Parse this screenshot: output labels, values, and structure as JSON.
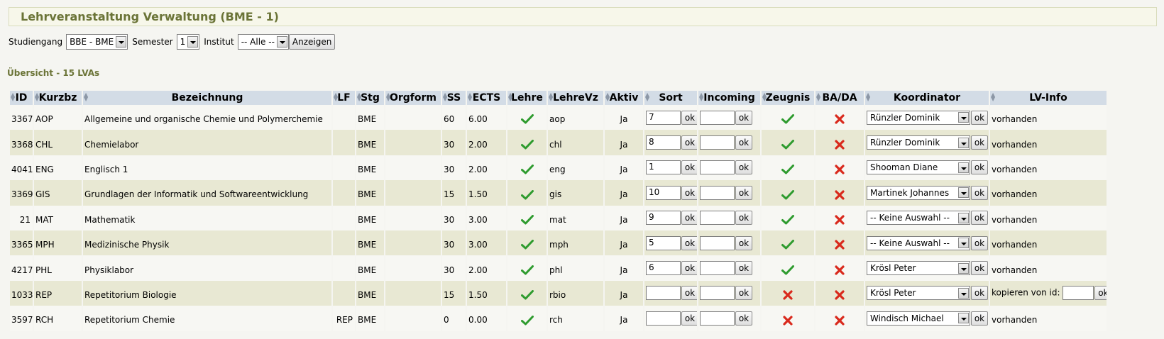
{
  "page": {
    "title": "Lehrveranstaltung Verwaltung (BME - 1)"
  },
  "filter": {
    "studiengang_label": "Studiengang",
    "studiengang_value": "BBE - BME",
    "semester_label": "Semester",
    "semester_value": "1",
    "institut_label": "Institut",
    "institut_value": "-- Alle --",
    "show_button": "Anzeigen"
  },
  "overview": "Übersicht - 15 LVAs",
  "table": {
    "headers": {
      "id": "ID",
      "kurzbz": "Kurzbz",
      "bezeichnung": "Bezeichnung",
      "lf": "LF",
      "stg": "Stg",
      "orgform": "Orgform",
      "ss": "SS",
      "ects": "ECTS",
      "lehre": "Lehre",
      "lehrevz": "LehreVz",
      "aktiv": "Aktiv",
      "sort": "Sort",
      "incoming": "Incoming",
      "zeugnis": "Zeugnis",
      "bada": "BA/DA",
      "koordinator": "Koordinator",
      "lvinfo": "LV-Info"
    },
    "ok_label": "ok",
    "rows": [
      {
        "id": "3367",
        "kurzbz": "AOP",
        "bezeichnung": "Allgemeine und organische Chemie und Polymerchemie",
        "lf": "",
        "stg": "BME",
        "orgform": "",
        "ss": "60",
        "ects": "6.00",
        "lehre": "check",
        "lehrevz": "aop",
        "aktiv": "Ja",
        "sort": "7",
        "incoming": "",
        "zeugnis": "check",
        "bada": "cross",
        "koordinator": "Rünzler Dominik",
        "lvinfo": "vorhanden"
      },
      {
        "id": "3368",
        "kurzbz": "CHL",
        "bezeichnung": "Chemielabor",
        "lf": "",
        "stg": "BME",
        "orgform": "",
        "ss": "30",
        "ects": "2.00",
        "lehre": "check",
        "lehrevz": "chl",
        "aktiv": "Ja",
        "sort": "8",
        "incoming": "",
        "zeugnis": "check",
        "bada": "cross",
        "koordinator": "Rünzler Dominik",
        "lvinfo": "vorhanden"
      },
      {
        "id": "4041",
        "kurzbz": "ENG",
        "bezeichnung": "Englisch 1",
        "lf": "",
        "stg": "BME",
        "orgform": "",
        "ss": "30",
        "ects": "2.00",
        "lehre": "check",
        "lehrevz": "eng",
        "aktiv": "Ja",
        "sort": "1",
        "incoming": "",
        "zeugnis": "check",
        "bada": "cross",
        "koordinator": "Shooman Diane",
        "lvinfo": "vorhanden"
      },
      {
        "id": "3369",
        "kurzbz": "GIS",
        "bezeichnung": "Grundlagen der Informatik und Softwareentwicklung",
        "lf": "",
        "stg": "BME",
        "orgform": "",
        "ss": "15",
        "ects": "1.50",
        "lehre": "check",
        "lehrevz": "gis",
        "aktiv": "Ja",
        "sort": "10",
        "incoming": "",
        "zeugnis": "check",
        "bada": "cross",
        "koordinator": "Martinek Johannes",
        "lvinfo": "vorhanden"
      },
      {
        "id": "21",
        "kurzbz": "MAT",
        "bezeichnung": "Mathematik",
        "lf": "",
        "stg": "BME",
        "orgform": "",
        "ss": "30",
        "ects": "3.00",
        "lehre": "check",
        "lehrevz": "mat",
        "aktiv": "Ja",
        "sort": "9",
        "incoming": "",
        "zeugnis": "check",
        "bada": "cross",
        "koordinator": "-- Keine Auswahl --",
        "lvinfo": "vorhanden"
      },
      {
        "id": "3365",
        "kurzbz": "MPH",
        "bezeichnung": "Medizinische Physik",
        "lf": "",
        "stg": "BME",
        "orgform": "",
        "ss": "30",
        "ects": "3.00",
        "lehre": "check",
        "lehrevz": "mph",
        "aktiv": "Ja",
        "sort": "5",
        "incoming": "",
        "zeugnis": "check",
        "bada": "cross",
        "koordinator": "-- Keine Auswahl --",
        "lvinfo": "vorhanden"
      },
      {
        "id": "4217",
        "kurzbz": "PHL",
        "bezeichnung": "Physiklabor",
        "lf": "",
        "stg": "BME",
        "orgform": "",
        "ss": "30",
        "ects": "2.00",
        "lehre": "check",
        "lehrevz": "phl",
        "aktiv": "Ja",
        "sort": "6",
        "incoming": "",
        "zeugnis": "check",
        "bada": "cross",
        "koordinator": "Krösl Peter",
        "lvinfo": "vorhanden"
      },
      {
        "id": "1033",
        "kurzbz": "REP",
        "bezeichnung": "Repetitorium Biologie",
        "lf": "",
        "stg": "BME",
        "orgform": "",
        "ss": "15",
        "ects": "1.50",
        "lehre": "check",
        "lehrevz": "rbio",
        "aktiv": "Ja",
        "sort": "",
        "incoming": "",
        "zeugnis": "cross",
        "bada": "cross",
        "koordinator": "Krösl Peter",
        "lvinfo": "kopieren von id:"
      },
      {
        "id": "3597",
        "kurzbz": "RCH",
        "bezeichnung": "Repetitorium Chemie",
        "lf": "REP",
        "stg": "BME",
        "orgform": "",
        "ss": "0",
        "ects": "0.00",
        "lehre": "check",
        "lehrevz": "rch",
        "aktiv": "Ja",
        "sort": "",
        "incoming": "",
        "zeugnis": "cross",
        "bada": "cross",
        "koordinator": "Windisch Michael",
        "lvinfo": "vorhanden"
      }
    ]
  },
  "colors": {
    "check": "#2e9b2e",
    "cross": "#d9291c",
    "header_bg": "#d3dce6",
    "title": "#6b7437"
  },
  "icons": {
    "check": "check-icon",
    "cross": "cross-icon",
    "sort": "sort-arrows-icon",
    "dropdown": "chevron-down-icon"
  }
}
